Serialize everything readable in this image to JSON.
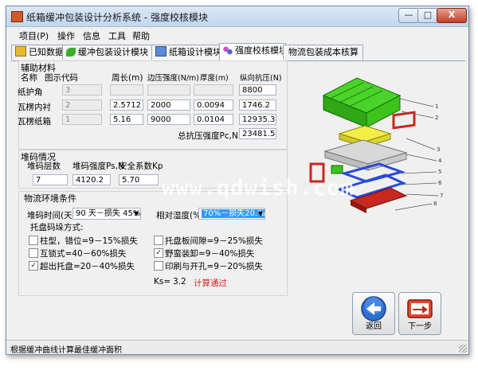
{
  "window": {
    "title": "纸箱缓冲包装设计分析系统 - 强度校核模块",
    "controls": {
      "min": "—",
      "max": "□",
      "close": "X"
    }
  },
  "menu": [
    "项目(P)",
    "操作",
    "信息",
    "工具",
    "帮助"
  ],
  "tabs": [
    {
      "label": "已知数据",
      "icon": "folder-icon",
      "active": false
    },
    {
      "label": "缓冲包装设计模块",
      "icon": "leaf-icon",
      "active": false
    },
    {
      "label": "纸箱设计模块",
      "icon": "box-icon",
      "active": false
    },
    {
      "label": "强度校核模块",
      "icon": "balls-icon",
      "active": true
    },
    {
      "label": "物流包装成本核算",
      "icon": "",
      "active": false
    }
  ],
  "aux": {
    "group_title": "辅助材料",
    "headers": {
      "name": "名称",
      "code": "图示代码",
      "perimeter": "周长(m)",
      "edge": "边压强度(N/m)",
      "thickness": "厚度(m)",
      "compress": "纵向抗压(N)"
    },
    "rows": [
      {
        "name": "纸护角",
        "code": "3",
        "perimeter": "",
        "edge": "",
        "thickness": "",
        "compress": "8800"
      },
      {
        "name": "瓦楞内衬",
        "code": "2",
        "perimeter": "2.5712",
        "edge": "2000",
        "thickness": "0.0094",
        "compress": "1746.2"
      },
      {
        "name": "瓦楞纸箱",
        "code": "1",
        "perimeter": "5.16",
        "edge": "9000",
        "thickness": "0.0104",
        "compress": "12935.3"
      }
    ],
    "total_label": "总抗压强度Pc,N",
    "total_value": "23481.5"
  },
  "stack": {
    "group_title": "堆码情况",
    "layers_label": "堆码层数",
    "layers_value": "7",
    "strength_label": "堆码强度Ps,N",
    "strength_value": "4120.2",
    "safety_label": "安全系数Kp",
    "safety_value": "5.70"
  },
  "env": {
    "group_title": "物流环境条件",
    "time_label": "堆码时间(天)",
    "time_value": "90 天－损失 45%",
    "humidity_label": "相对湿度(%)",
    "humidity_value": "70%－损失20.%",
    "pallet_label": "托盘码垛方式:",
    "options_left": [
      {
        "label": "柱型，错位=9－15%损失",
        "checked": false
      },
      {
        "label": "互锁式=40－60%损失",
        "checked": false
      },
      {
        "label": "超出托盘=20－40%损失",
        "checked": true
      }
    ],
    "options_right": [
      {
        "label": "托盘板间隙=9－25%损失",
        "checked": false
      },
      {
        "label": "野蛮装卸=9－40%损失",
        "checked": true
      },
      {
        "label": "印刷与开孔=9－20%损失",
        "checked": false
      }
    ],
    "ks_label": "Ks=",
    "ks_value": "3.2",
    "result": "计算通过"
  },
  "buttons": {
    "back": "返回",
    "next": "下一步"
  },
  "status": "根据缓冲曲线计算最佳缓冲面积",
  "watermark": "www.qdwish.com",
  "diagram": {
    "callouts": [
      "1",
      "2",
      "3",
      "4",
      "5",
      "6",
      "7",
      "8"
    ]
  },
  "colors": {
    "green": "#35c21b",
    "yellow": "#e8e43a",
    "red": "#c8281e",
    "blue": "#2a4bd6",
    "gray": "#c8c8c8"
  }
}
